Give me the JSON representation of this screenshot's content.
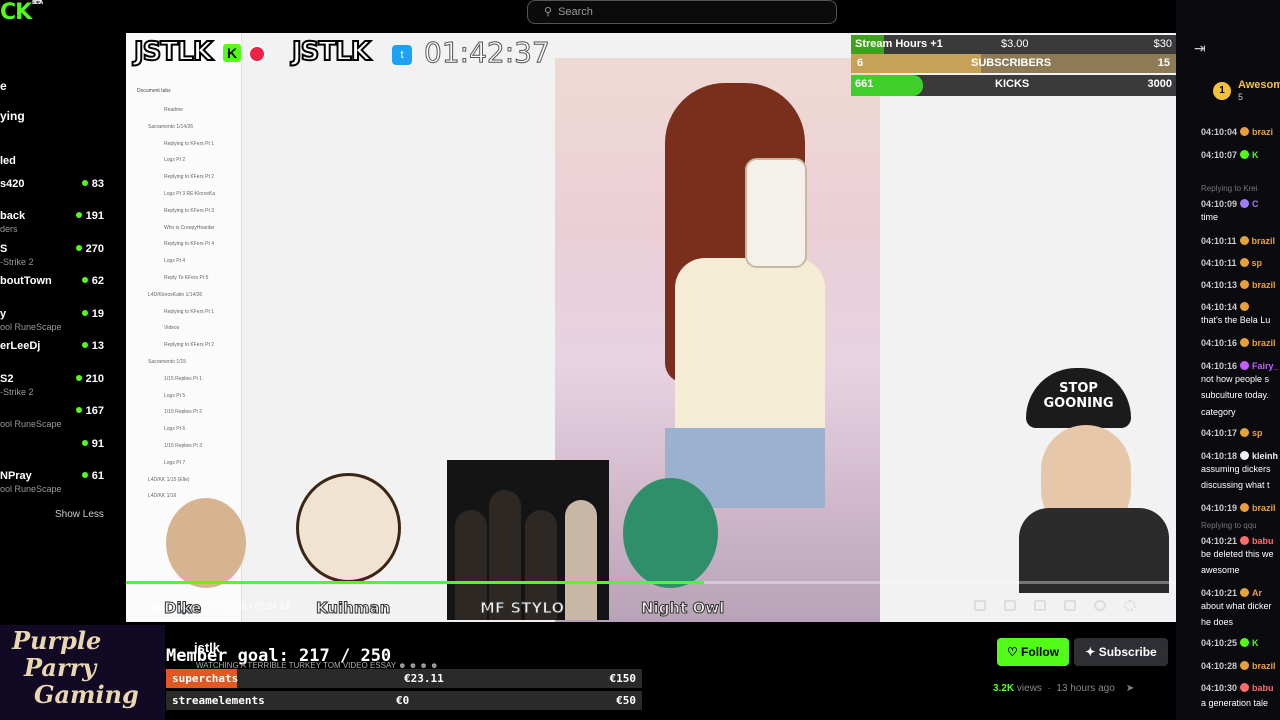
{
  "search": {
    "placeholder": "Search"
  },
  "brand": {
    "logo": "CK",
    "beta": "BETA"
  },
  "sidebar": {
    "labels": [
      "e",
      "ying",
      "led"
    ],
    "channels": [
      {
        "name": "s420",
        "category": "",
        "viewers": "83"
      },
      {
        "name": "back",
        "category": "ders",
        "viewers": "191"
      },
      {
        "name": "S",
        "category": "-Strike 2",
        "viewers": "270"
      },
      {
        "name": "boutTown",
        "category": "",
        "viewers": "62"
      },
      {
        "name": "y",
        "category": "ool RuneScape",
        "viewers": "19"
      },
      {
        "name": "erLeeDj",
        "category": "",
        "viewers": "13"
      },
      {
        "name": "S2",
        "category": "-Strike 2",
        "viewers": "210"
      },
      {
        "name": "",
        "category": "ool RuneScape",
        "viewers": "167"
      },
      {
        "name": "",
        "category": "",
        "viewers": "91"
      },
      {
        "name": "NPray",
        "category": "ool RuneScape",
        "viewers": "61"
      }
    ],
    "show_less": "Show Less"
  },
  "video": {
    "overlay_title_left": "JSTLK",
    "kick_badge": "K",
    "overlay_title_mid": "JSTLK",
    "twitter_badge": "t",
    "stream_time": "01:42:37",
    "doc_heading": "Document tabs",
    "doc_items": [
      "Readme",
      "Sacramento 1/14/26",
      "Replying to KFers Pt 1",
      "Logs Pt 2",
      "Replying to KFers Pt 2",
      "Logs Pt 3 RE:KloroxKa",
      "Replying to KFers Pt 3",
      "Who is CreepyHoarder",
      "Replying to KFers Pt 4",
      "Logs Pt 4",
      "Reply To KFers Pt 5",
      "L4D/KloroxKatie 1/14/26",
      "Replying to KFers Pt 1",
      "Videos",
      "Replying to KFers Pt 2",
      "Sacramento 1/15",
      "1/15 Replies Pt 1",
      "Logs Pt 5",
      "1/15 Replies Pt 2",
      "Logs Pt 6",
      "1/15 Replies Pt 3",
      "Logs Pt 7",
      "L4D/KK 1/15 (Elle)",
      "L4D/KK 1/16"
    ],
    "goals": {
      "stream_hours": {
        "label": "Stream Hours +1",
        "amount": "$3.00",
        "target": "$30",
        "progress": 0.1
      },
      "subscribers": {
        "current": "6",
        "label": "SUBSCRIBERS",
        "target": "15",
        "progress": 0.4
      },
      "kicks": {
        "current": "661",
        "label": "KICKS",
        "target": "3000",
        "progress": 0.22
      }
    },
    "cohosts": [
      "Dike",
      "Kuihman",
      "MF STYLO",
      "Night Owl"
    ],
    "stop_sign": "STOP GOONING",
    "timecode": "04:10:35 / 07:34:14",
    "progress": 0.55
  },
  "overlay_bottom": {
    "channel_logo_lines": [
      "Purple",
      "Parry",
      "Gaming"
    ],
    "streamer_name": "jstlk",
    "member_goal": "Member goal: 217 / 250",
    "ticker": "WATCHING A TERRIBLE TURKEY TOM VIDEO ESSAY ☻ ☻ ☻ ☻",
    "donations": [
      {
        "label": "superchats",
        "amount": "€23.11",
        "goal": "€150",
        "progress": 0.15
      },
      {
        "label": "streamelements",
        "amount": "€0",
        "goal": "€50",
        "progress": 0
      }
    ]
  },
  "actions": {
    "follow": "Follow",
    "subscribe": "Subscribe",
    "views": "3.2K",
    "views_label": "views",
    "age": "13 hours ago"
  },
  "chat": {
    "pinned": {
      "rank": "1",
      "name": "Awesom",
      "count": "5"
    },
    "messages": [
      {
        "time": "04:10:04",
        "user": "brazi",
        "color": "#e8a13a",
        "text": ""
      },
      {
        "time": "04:10:07",
        "user": "K",
        "color": "#53fc18",
        "text": ""
      },
      {
        "time": "04:10:09",
        "user": "C",
        "color": "#a07cff",
        "text": "time"
      },
      {
        "time": "04:10:11",
        "user": "brazil",
        "color": "#e8a13a",
        "text": ""
      },
      {
        "time": "04:10:11",
        "user": "sp",
        "color": "#e8a13a",
        "text": ""
      },
      {
        "time": "04:10:13",
        "user": "brazil",
        "color": "#e8a13a",
        "text": ""
      },
      {
        "time": "04:10:14",
        "user": "",
        "color": "#e8a13a",
        "text": "that's the Bela Lu"
      },
      {
        "time": "04:10:16",
        "user": "brazil",
        "color": "#e8a13a",
        "text": ""
      },
      {
        "time": "04:10:16",
        "user": "Fairy_",
        "color": "#c45cff",
        "text": "not how people s"
      },
      {
        "time": "04:10:17",
        "user": "sp",
        "color": "#e8a13a",
        "text": ""
      },
      {
        "time": "04:10:18",
        "user": "kleinh",
        "color": "#f0f0f0",
        "text": "assuming dickers"
      },
      {
        "time": "04:10:19",
        "user": "brazil",
        "color": "#e8a13a",
        "text": ""
      },
      {
        "time": "04:10:21",
        "user": "babu",
        "color": "#ff6b6b",
        "text": "be deleted this we"
      },
      {
        "time": "04:10:21",
        "user": "Ar",
        "color": "#e8a13a",
        "text": "about what dicker"
      },
      {
        "time": "04:10:25",
        "user": "K",
        "color": "#53fc18",
        "text": ""
      },
      {
        "time": "04:10:28",
        "user": "brazil",
        "color": "#e8a13a",
        "text": ""
      },
      {
        "time": "04:10:30",
        "user": "babu",
        "color": "#ff6b6b",
        "text": ""
      }
    ],
    "continuations": [
      "subculture today.",
      "category",
      "discussing what t",
      "awesome",
      "he does",
      "a generation tale"
    ],
    "replies": [
      "Replying to Krei",
      "Replying to qqu"
    ]
  }
}
